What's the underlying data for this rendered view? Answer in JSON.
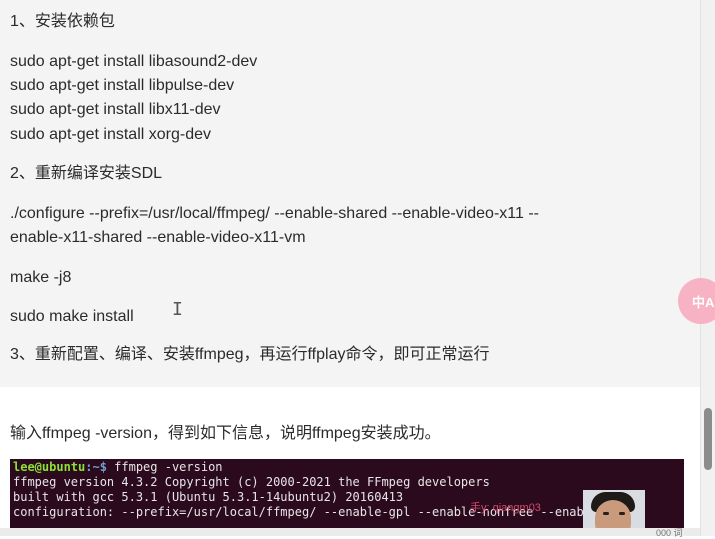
{
  "step1": {
    "heading": "1、安装依赖包",
    "commands": [
      "sudo apt-get install libasound2-dev",
      "sudo apt-get install libpulse-dev",
      "sudo apt-get install libx11-dev",
      "sudo apt-get install xorg-dev"
    ]
  },
  "step2": {
    "heading": "2、重新编译安装SDL",
    "configure_line1": "./configure --prefix=/usr/local/ffmpeg/ --enable-shared --enable-video-x11 --",
    "configure_line2": "enable-x11-shared --enable-video-x11-vm",
    "make": "make -j8",
    "install": "sudo make install"
  },
  "step3": {
    "heading": "3、重新配置、编译、安装ffmpeg，再运行ffplay命令，即可正常运行"
  },
  "verify_text": "输入ffmpeg -version，得到如下信息，说明ffmpeg安装成功。",
  "terminal": {
    "prompt_user": "lee@ubuntu",
    "prompt_path": ":~$",
    "command": " ffmpeg -version",
    "lines": [
      "ffmpeg version 4.3.2 Copyright (c) 2000-2021 the FFmpeg developers",
      "built with gcc 5.3.1 (Ubuntu 5.3.1-14ubuntu2) 20160413",
      "configuration: --prefix=/usr/local/ffmpeg/ --enable-gpl --enable-nonfree --enabl"
    ]
  },
  "watermark": "手y: qiangm03",
  "float_button": "中A",
  "bottom_count": "000 词",
  "colors": {
    "terminal_bg": "#2c0a1e",
    "prompt_user": "#8ae234",
    "float_button": "#f7b3c4"
  },
  "icons": {
    "text_cursor": "i-beam-cursor",
    "float_button": "translate-icon"
  }
}
